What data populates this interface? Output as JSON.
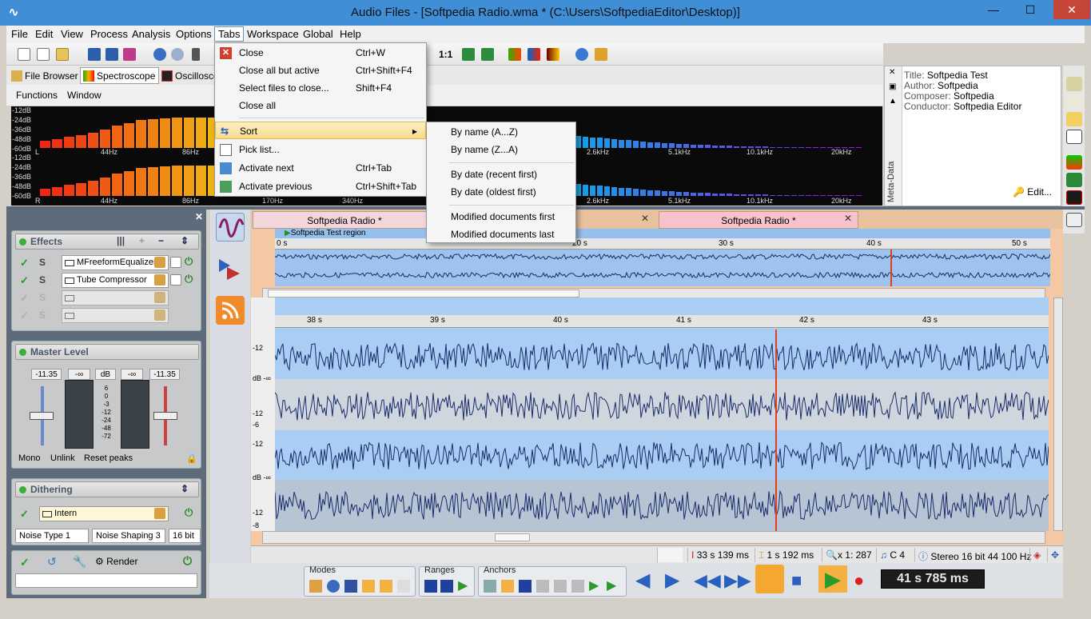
{
  "window": {
    "title": "Audio Files - [Softpedia Radio.wma * (C:\\Users\\SoftpediaEditor\\Desktop)]",
    "min_glyph": "—",
    "max_glyph": "☐",
    "close_glyph": "✕"
  },
  "menu": [
    "File",
    "Edit",
    "View",
    "Process",
    "Analysis",
    "Options",
    "Tabs",
    "Workspace",
    "Global",
    "Help"
  ],
  "toolbar": {
    "ratio_label": "1:1"
  },
  "panel_tabs": [
    "File Browser",
    "Spectroscope",
    "Oscilloscope"
  ],
  "function_bar": [
    "Functions",
    "Window"
  ],
  "spectroscope": {
    "db_labels": [
      "-12dB",
      "-24dB",
      "-36dB",
      "-48dB",
      "-60dB"
    ],
    "channel_left": "L",
    "channel_right": "R",
    "freq_top": [
      "44Hz",
      "86Hz",
      "2.6kHz",
      "5.1kHz",
      "10.1kHz",
      "20kHz"
    ],
    "freq_bottom": [
      "44Hz",
      "86Hz",
      "170Hz",
      "340Hz",
      "2.6kHz",
      "5.1kHz",
      "10.1kHz",
      "20kHz"
    ],
    "bars_top": [
      0.18,
      0.22,
      0.28,
      0.32,
      0.38,
      0.45,
      0.55,
      0.62,
      0.7,
      0.72,
      0.74,
      0.75,
      0.76,
      0.76,
      0.75,
      0.74,
      0.73
    ],
    "bars_top_right": [
      0.3,
      0.28,
      0.26,
      0.25,
      0.23,
      0.22,
      0.2,
      0.19,
      0.17,
      0.16,
      0.14,
      0.13,
      0.12,
      0.11,
      0.1,
      0.09,
      0.08,
      0.07,
      0.07,
      0.06,
      0.05,
      0.05,
      0.04,
      0.04,
      0.03,
      0.03,
      0.03,
      0.02,
      0.02,
      0.02,
      0.02,
      0.02,
      0.02,
      0.02,
      0.02,
      0.02,
      0.01,
      0.01,
      0.01,
      0.01
    ]
  },
  "metadata": {
    "title_key": "Title:",
    "title_val": "Softpedia Test",
    "author_key": "Author:",
    "author_val": "Softpedia",
    "composer_key": "Composer:",
    "composer_val": "Softpedia",
    "conductor_key": "Conductor:",
    "conductor_val": "Softpedia Editor",
    "side_label": "Meta-Data",
    "edit_label": "Edit..."
  },
  "effects": {
    "header": "Effects",
    "slots": [
      {
        "name": "MFreeformEqualizer",
        "active": true
      },
      {
        "name": "Tube Compressor",
        "active": true
      },
      {
        "name": "",
        "active": false
      },
      {
        "name": "",
        "active": false
      }
    ],
    "check_glyph": "✓",
    "s_glyph": "S"
  },
  "master_level": {
    "header": "Master Level",
    "left_val": "-11.35",
    "left_inf": "-∞",
    "db_label": "dB",
    "right_inf": "-∞",
    "right_val": "-11.35",
    "scale": [
      "6",
      "0",
      "-3",
      "-12",
      "-24",
      "-48",
      "-72"
    ],
    "mono": "Mono",
    "unlink": "Unlink",
    "reset": "Reset peaks"
  },
  "dithering": {
    "header": "Dithering",
    "mode": "Intern",
    "noise_type": "Noise Type 1",
    "noise_shaping": "Noise Shaping 3",
    "bits": "16 bit"
  },
  "render": {
    "label": "Render"
  },
  "doc_tabs": [
    {
      "label": "Softpedia Radio *"
    },
    {
      "label": "Softpedia Radio *"
    }
  ],
  "tab_close_glyph": "✕",
  "overview": {
    "region_label": "Softpedia Test region",
    "ruler": [
      "0 s",
      "20 s",
      "30 s",
      "40 s",
      "50 s"
    ]
  },
  "main_wave": {
    "ruler": [
      "38 s",
      "39 s",
      "40 s",
      "41 s",
      "42 s",
      "43 s"
    ],
    "axis": [
      "-12",
      "dB -∞",
      "-12",
      "-6",
      "-12",
      "dB -∞",
      "-12",
      "-8"
    ]
  },
  "status": {
    "position": "33 s 139 ms",
    "length": "1 s 192 ms",
    "zoom": "x 1: 287",
    "note": "C 4",
    "format": "Stereo 16 bit 44 100 Hz"
  },
  "transport": {
    "modes_label": "Modes",
    "ranges_label": "Ranges",
    "anchors_label": "Anchors",
    "time": "41 s 785 ms"
  },
  "tabs_menu": {
    "items": [
      {
        "label": "Close",
        "shortcut": "Ctrl+W"
      },
      {
        "label": "Close all but active",
        "shortcut": "Ctrl+Shift+F4"
      },
      {
        "label": "Select files to close...",
        "shortcut": "Shift+F4"
      },
      {
        "label": "Close all",
        "shortcut": ""
      },
      {
        "label": "Sort",
        "shortcut": "▸"
      },
      {
        "label": "Pick list...",
        "shortcut": ""
      },
      {
        "label": "Activate next",
        "shortcut": "Ctrl+Tab"
      },
      {
        "label": "Activate previous",
        "shortcut": "Ctrl+Shift+Tab"
      }
    ]
  },
  "sort_submenu": {
    "items": [
      "By name (A...Z)",
      "By name (Z...A)",
      "By date (recent first)",
      "By date (oldest first)",
      "Modified documents first",
      "Modified documents last"
    ]
  },
  "colors": {
    "accent": "#3f8ed6",
    "wave_bg": "#a9cdf3",
    "wave_line": "#1a2c6a",
    "cursor": "#e04020"
  }
}
